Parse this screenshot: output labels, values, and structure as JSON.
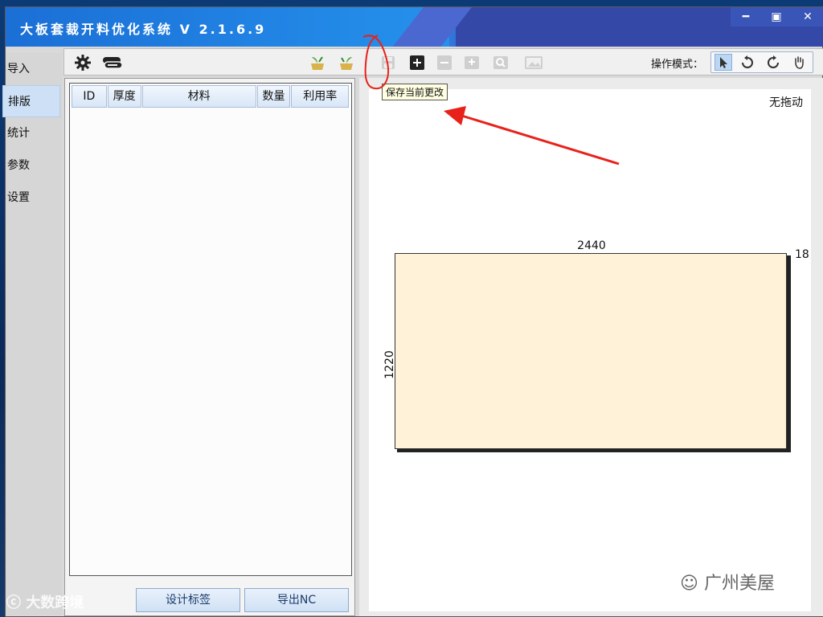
{
  "window": {
    "title": "大板套裁开料优化系统 V 2.1.6.9",
    "controls": {
      "minimize": "━",
      "maximize": "▣",
      "close": "✕"
    }
  },
  "nav": {
    "items": [
      {
        "label": "导入"
      },
      {
        "label": "排版",
        "active": true
      },
      {
        "label": "统计"
      },
      {
        "label": "参数"
      },
      {
        "label": "设置"
      }
    ]
  },
  "toolbar": {
    "icons": [
      "gear-icon",
      "layers-icon",
      "import-plant-icon",
      "export-plant-icon",
      "save-icon",
      "add-icon",
      "remove-icon",
      "add-box-icon",
      "search-box-icon",
      "image-icon"
    ],
    "mode_label": "操作模式：",
    "modes": [
      "pointer-icon",
      "rotate-ccw-icon",
      "rotate-cw-icon",
      "hand-icon"
    ]
  },
  "tooltip": {
    "text": "保存当前更改"
  },
  "table": {
    "columns": [
      "ID",
      "厚度",
      "材料",
      "数量",
      "利用率"
    ],
    "rows": []
  },
  "panel_buttons": {
    "design_label": "设计标签",
    "export_nc": "导出NC"
  },
  "canvas": {
    "drag_status": "无拖动",
    "board": {
      "width_label": "2440",
      "height_label": "1220",
      "thickness_label": "18"
    }
  },
  "watermarks": {
    "left": "大数跨境",
    "right": "广州美屋"
  },
  "colors": {
    "title_bar": "#1b74d9",
    "board_fill": "#fff2d8",
    "annotation_red": "#e8221b"
  }
}
